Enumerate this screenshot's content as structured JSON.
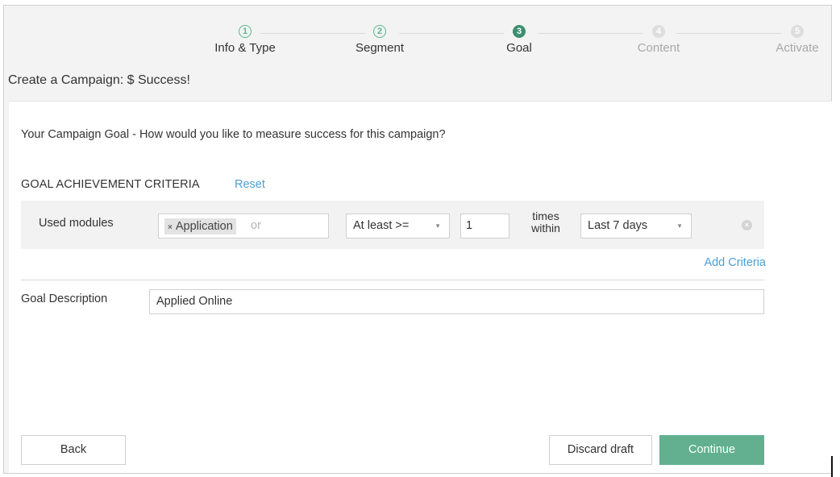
{
  "stepper": {
    "steps": [
      {
        "number": "1",
        "label": "Info & Type",
        "state": "done"
      },
      {
        "number": "2",
        "label": "Segment",
        "state": "done"
      },
      {
        "number": "3",
        "label": "Goal",
        "state": "current"
      },
      {
        "number": "4",
        "label": "Content",
        "state": "todo"
      },
      {
        "number": "5",
        "label": "Activate",
        "state": "todo"
      }
    ]
  },
  "page": {
    "title": "Create a Campaign: $ Success!"
  },
  "goal": {
    "question": "Your Campaign Goal - How would you like to measure success for this campaign?",
    "criteria_title": "GOAL ACHIEVEMENT CRITERIA",
    "reset_label": "Reset",
    "criteria": {
      "label": "Used modules",
      "tag": "Application",
      "tag_remove": "×",
      "or_text": "or",
      "operator": "At least >=",
      "count": "1",
      "times_line1": "times",
      "times_line2": "within",
      "period": "Last 7 days",
      "remove_icon": "×"
    },
    "add_criteria_label": "Add Criteria",
    "description_label": "Goal Description",
    "description_value": "Applied Online"
  },
  "footer": {
    "back_label": "Back",
    "discard_label": "Discard draft",
    "continue_label": "Continue"
  },
  "colors": {
    "accent_green": "#62b08f",
    "step_done": "#5bb591",
    "step_current": "#3b8f70",
    "link_blue": "#4a9fd5"
  },
  "icons": {
    "dropdown": "chevron-down-icon",
    "remove_criteria": "close-circle-icon",
    "tag_remove": "close-icon"
  }
}
